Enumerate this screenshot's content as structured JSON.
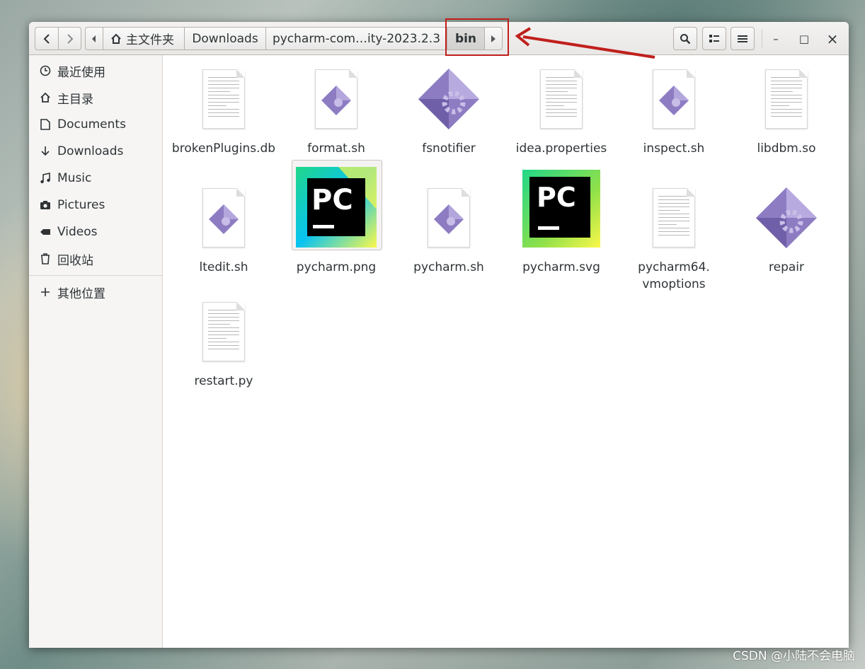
{
  "toolbar": {
    "back_icon": "chevron-left-icon",
    "forward_icon": "chevron-right-icon",
    "breadcrumbs": [
      "主文件夹",
      "Downloads",
      "pycharm-com…ity-2023.2.3",
      "bin"
    ],
    "search_icon": "search-icon",
    "view_icon": "view-toggle-icon",
    "menu_icon": "menu-icon",
    "minimize": "–",
    "maximize": "□",
    "close": "×"
  },
  "sidebar": {
    "items": [
      {
        "label": "最近使用",
        "icon": "clock-icon"
      },
      {
        "label": "主目录",
        "icon": "home-icon"
      },
      {
        "label": "Documents",
        "icon": "document-icon"
      },
      {
        "label": "Downloads",
        "icon": "download-icon"
      },
      {
        "label": "Music",
        "icon": "music-icon"
      },
      {
        "label": "Pictures",
        "icon": "camera-icon"
      },
      {
        "label": "Videos",
        "icon": "video-icon"
      },
      {
        "label": "回收站",
        "icon": "trash-icon"
      }
    ],
    "other_locations": {
      "label": "其他位置",
      "icon": "plus-icon"
    }
  },
  "files": [
    {
      "name": "brokenPlugins.db",
      "type": "text"
    },
    {
      "name": "format.sh",
      "type": "script"
    },
    {
      "name": "fsnotifier",
      "type": "executable"
    },
    {
      "name": "idea.properties",
      "type": "text"
    },
    {
      "name": "inspect.sh",
      "type": "script"
    },
    {
      "name": "libdbm.so",
      "type": "text"
    },
    {
      "name": "ltedit.sh",
      "type": "script"
    },
    {
      "name": "pycharm.png",
      "type": "pycharm-png"
    },
    {
      "name": "pycharm.sh",
      "type": "script"
    },
    {
      "name": "pycharm.svg",
      "type": "pycharm-svg"
    },
    {
      "name": "pycharm64.\nvmoptions",
      "type": "text"
    },
    {
      "name": "repair",
      "type": "executable"
    },
    {
      "name": "restart.py",
      "type": "text"
    }
  ],
  "icon_text": "PC",
  "watermark": "CSDN @小陆不会电脑",
  "colors": {
    "annotation": "#c0201c",
    "exec_purple": "#8e7cc3"
  }
}
